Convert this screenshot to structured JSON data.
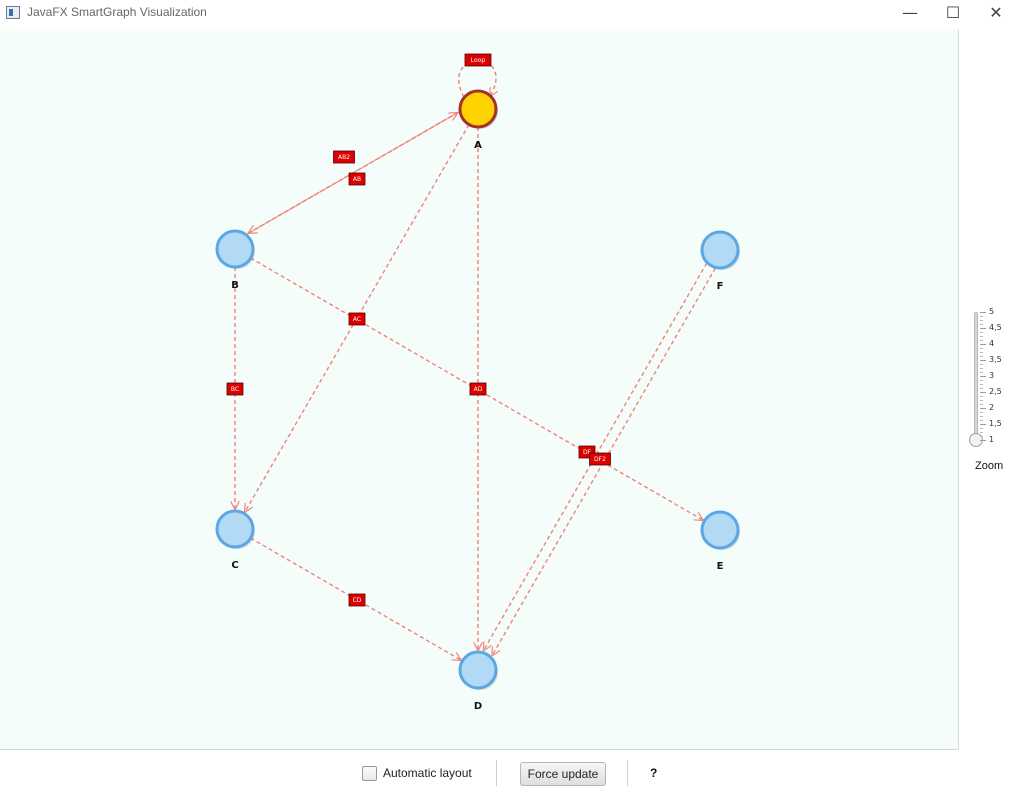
{
  "window": {
    "title": "JavaFX SmartGraph Visualization",
    "minimize_icon": "minimize-icon",
    "maximize_icon": "maximize-icon",
    "close_icon": "close-icon"
  },
  "graph": {
    "vertex_fill": "#b3daf5",
    "vertex_stroke": "#5aa7e3",
    "selected_fill": "#ffd300",
    "selected_stroke": "#a0332b",
    "edge_color": "#f08278",
    "edge_label_fill": "#dd0000",
    "vertices": [
      {
        "id": "A",
        "label": "A",
        "selected": true
      },
      {
        "id": "B",
        "label": "B",
        "selected": false
      },
      {
        "id": "C",
        "label": "C",
        "selected": false
      },
      {
        "id": "D",
        "label": "D",
        "selected": false
      },
      {
        "id": "E",
        "label": "E",
        "selected": false
      },
      {
        "id": "F",
        "label": "F",
        "selected": false
      }
    ],
    "edges": [
      {
        "label": "Loop",
        "from": "A",
        "to": "A"
      },
      {
        "label": "AB2",
        "from": "B",
        "to": "A"
      },
      {
        "label": "AB",
        "from": "A",
        "to": "B"
      },
      {
        "label": "AC",
        "from": "A",
        "to": "C"
      },
      {
        "label": "AD",
        "from": "A",
        "to": "D"
      },
      {
        "label": "BC",
        "from": "B",
        "to": "C"
      },
      {
        "label": "CD",
        "from": "C",
        "to": "D"
      },
      {
        "label": "DF",
        "from": "F",
        "to": "D"
      },
      {
        "label": "DF2",
        "from": "F",
        "to": "D"
      },
      {
        "label": "BE",
        "from": "B",
        "to": "E"
      }
    ]
  },
  "zoom": {
    "label": "Zoom",
    "ticks": [
      "5",
      "4,5",
      "4",
      "3,5",
      "3",
      "2,5",
      "2",
      "1,5",
      "1"
    ],
    "min": 1,
    "max": 5,
    "value": 1
  },
  "toolbar": {
    "auto_layout_label": "Automatic layout",
    "auto_layout_checked": false,
    "force_update_label": "Force update",
    "help_label": "?"
  }
}
